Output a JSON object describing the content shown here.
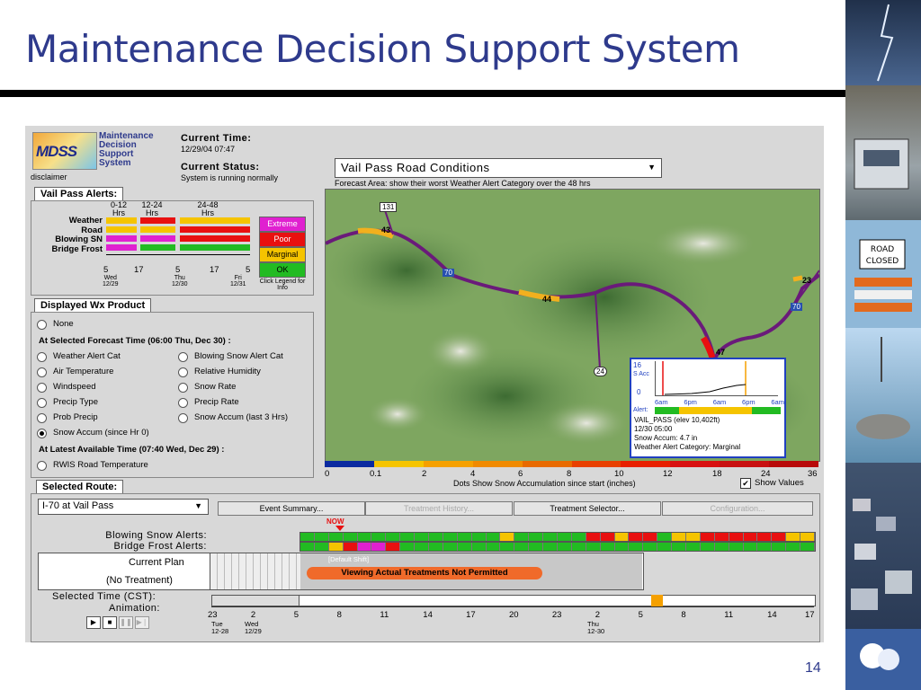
{
  "slide": {
    "title": "Maintenance Decision Support System",
    "page_number": "14"
  },
  "app": {
    "logo_text": "MDSS",
    "app_name": [
      "Maintenance",
      "Decision",
      "Support",
      "System"
    ],
    "disclaimer": "disclaimer",
    "current_time_label": "Current Time:",
    "current_time_value": "12/29/04 07:47",
    "current_status_label": "Current Status:",
    "current_status_value": "System is running normally"
  },
  "alerts": {
    "tab": "Vail Pass Alerts:",
    "col_headers": [
      "0-12\nHrs",
      "12-24\nHrs",
      "24-48\nHrs"
    ],
    "rows": [
      "Weather",
      "Road",
      "Blowing SN",
      "Bridge Frost"
    ],
    "legend": [
      "Extreme",
      "Poor",
      "Marginal",
      "OK"
    ],
    "legend_note": "Click Legend for Info",
    "axis_ticks": [
      "5",
      "17",
      "5",
      "17",
      "5"
    ],
    "axis_days": [
      {
        "day": "Wed",
        "date": "12/29"
      },
      {
        "day": "Thu",
        "date": "12/30"
      },
      {
        "day": "Fri",
        "date": "12/31"
      }
    ]
  },
  "wx": {
    "tab": "Displayed Wx Product",
    "none_label": "None",
    "selected_time_header": "At Selected Forecast Time (06:00 Thu, Dec 30) :",
    "options": [
      "Weather Alert Cat",
      "Blowing Snow Alert Cat",
      "Air Temperature",
      "Relative Humidity",
      "Windspeed",
      "Snow Rate",
      "Precip Type",
      "Precip Rate",
      "Prob Precip",
      "Snow Accum (last 3 Hrs)",
      "Snow Accum (since Hr 0)"
    ],
    "latest_header": "At Latest Available Time (07:40 Wed, Dec 29) :",
    "rwis_label": "RWIS Road Temperature"
  },
  "map": {
    "dropdown_value": "Vail Pass Road Conditions",
    "forecast_area_note": "Forecast Area: show their worst Weather Alert Category over the 48 hrs",
    "route_markers": [
      "131",
      "43",
      "70",
      "44",
      "24",
      "47",
      "70",
      "23"
    ],
    "popup": {
      "y_top": "16",
      "y_label": "S Acc",
      "y_bottom": "0",
      "x_ticks": [
        "6am",
        "6pm",
        "6am",
        "6pm",
        "6am"
      ],
      "alert_label": "Alert:",
      "lines": [
        "VAIL_PASS (elev 10,402ft)",
        "12/30 05:00",
        "Snow Accum: 4.7 in",
        "Weather Alert Category: Marginal"
      ]
    },
    "scale_ticks": [
      "0",
      "0.1",
      "2",
      "4",
      "6",
      "8",
      "10",
      "12",
      "18",
      "24",
      "36"
    ],
    "scale_caption": "Dots Show Snow Accumulation since start (inches)",
    "show_values_label": "Show Values",
    "colors": {
      "route": "#6a1a7a",
      "highway_shield": "#2850b0"
    }
  },
  "route": {
    "tab": "Selected Route:",
    "selected_route": "I-70 at Vail Pass",
    "buttons": [
      {
        "label": "Event Summary...",
        "enabled": true
      },
      {
        "label": "Treatment History...",
        "enabled": false
      },
      {
        "label": "Treatment Selector...",
        "enabled": true
      },
      {
        "label": "Configuration...",
        "enabled": false
      }
    ],
    "now_label": "NOW",
    "blowing_label": "Blowing Snow Alerts:",
    "frost_label": "Bridge Frost Alerts:",
    "current_plan_label": "Current Plan",
    "no_treatment_label": "(No Treatment)",
    "default_shift": "[Default Shift]",
    "not_permitted": "Viewing Actual Treatments Not Permitted",
    "selected_time_label": "Selected Time (CST):",
    "animation_label": "Animation:",
    "time_ticks": [
      "23",
      "2",
      "5",
      "8",
      "11",
      "14",
      "17",
      "20",
      "23",
      "2",
      "5",
      "8",
      "11",
      "14",
      "17"
    ],
    "time_days": [
      {
        "day": "Tue",
        "date": "12-28"
      },
      {
        "day": "Wed",
        "date": "12/29"
      },
      {
        "day": "Thu",
        "date": "12-30"
      }
    ]
  },
  "status_colors": {
    "ok": "#22bb22",
    "marginal": "#f5c400",
    "poor": "#e81010",
    "extreme": "#e020d0"
  },
  "blowing_snow_alerts": [
    "ok",
    "ok",
    "ok",
    "ok",
    "ok",
    "ok",
    "ok",
    "ok",
    "ok",
    "ok",
    "ok",
    "ok",
    "ok",
    "ok",
    "marginal",
    "ok",
    "ok",
    "ok",
    "ok",
    "ok",
    "poor",
    "poor",
    "marginal",
    "poor",
    "poor",
    "ok",
    "marginal",
    "marginal",
    "poor",
    "poor",
    "poor",
    "poor",
    "poor",
    "poor",
    "marginal",
    "marginal"
  ],
  "bridge_frost_alerts": [
    "ok",
    "ok",
    "marginal",
    "poor",
    "extreme",
    "extreme",
    "poor",
    "ok",
    "ok",
    "ok",
    "ok",
    "ok",
    "ok",
    "ok",
    "ok",
    "ok",
    "ok",
    "ok",
    "ok",
    "ok",
    "ok",
    "ok",
    "ok",
    "ok",
    "ok",
    "ok",
    "ok",
    "ok",
    "ok",
    "ok",
    "ok",
    "ok",
    "ok",
    "ok",
    "ok",
    "ok"
  ]
}
